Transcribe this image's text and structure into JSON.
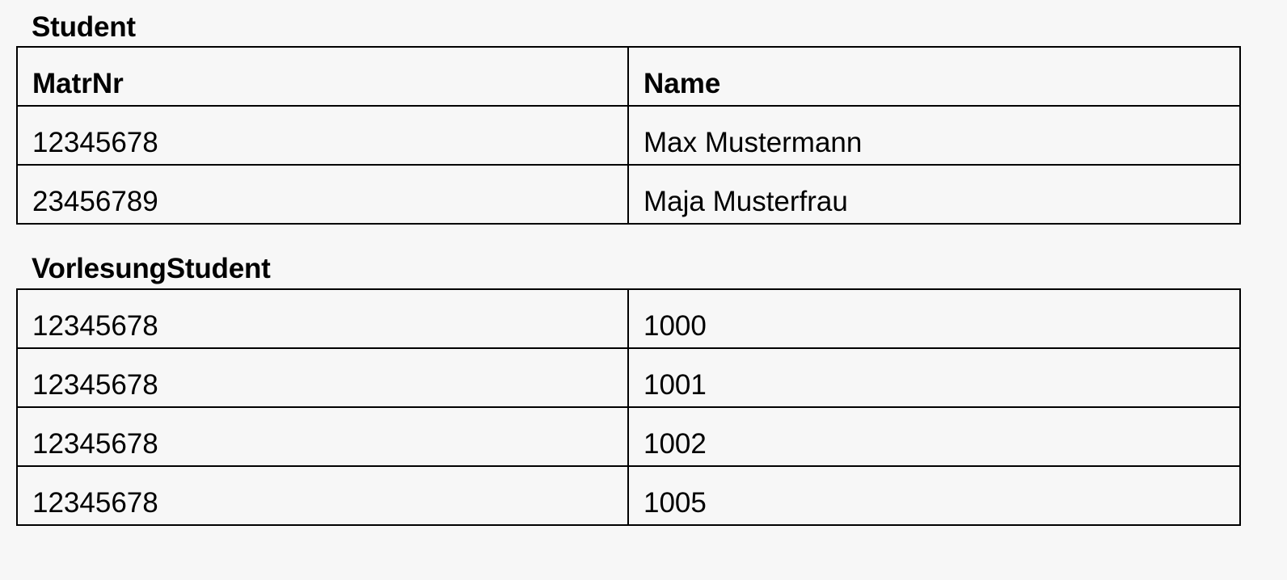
{
  "student": {
    "title": "Student",
    "columns": [
      "MatrNr",
      "Name"
    ],
    "rows": [
      [
        "12345678",
        "Max Mustermann"
      ],
      [
        "23456789",
        "Maja Musterfrau"
      ]
    ]
  },
  "vorlesung_student": {
    "title": "VorlesungStudent",
    "rows": [
      [
        "12345678",
        "1000"
      ],
      [
        "12345678",
        "1001"
      ],
      [
        "12345678",
        "1002"
      ],
      [
        "12345678",
        "1005"
      ]
    ]
  }
}
